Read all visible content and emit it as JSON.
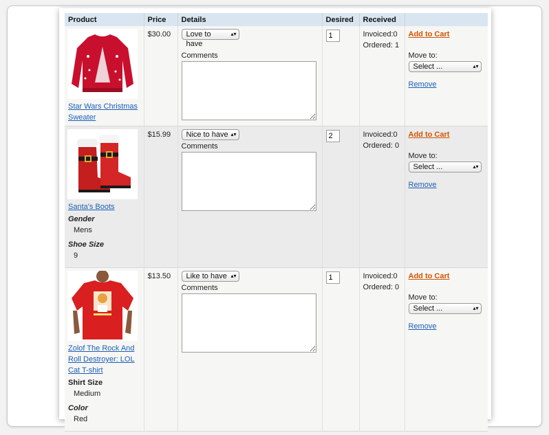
{
  "table": {
    "headers": {
      "product": "Product",
      "price": "Price",
      "details": "Details",
      "desired": "Desired",
      "received": "Received",
      "actions": ""
    },
    "common": {
      "comments_label": "Comments",
      "add_to_cart": "Add to Cart",
      "move_to_label": "Move to:",
      "move_to_select": "Select ...",
      "remove": "Remove",
      "accent_color": "#d35400",
      "link_color": "#1a5fb4",
      "header_bg": "#d9e5f0"
    },
    "rows": [
      {
        "name": "Star Wars Christmas Sweater",
        "image_icon": "red-christmas-sweater-image",
        "price": "$30.00",
        "priority": "Love to have",
        "comments": "",
        "desired": "1",
        "invoiced": "Invoiced:0",
        "ordered": "Ordered: 1",
        "attributes": []
      },
      {
        "name": "Santa's Boots",
        "image_icon": "red-santa-boots-image",
        "price": "$15.99",
        "priority": "Nice to have",
        "comments": "",
        "desired": "2",
        "invoiced": "Invoiced:0",
        "ordered": "Ordered: 0",
        "attributes": [
          {
            "name": "Gender",
            "value": "Mens"
          },
          {
            "name": "Shoe Size",
            "value": "9"
          }
        ]
      },
      {
        "name": "Zolof The Rock And Roll Destroyer: LOL Cat T-shirt",
        "image_icon": "red-cat-tshirt-image",
        "price": "$13.50",
        "priority": "Like to have",
        "comments": "",
        "desired": "1",
        "invoiced": "Invoiced:0",
        "ordered": "Ordered: 0",
        "attributes": [
          {
            "name": "Shirt Size",
            "value": "Medium"
          },
          {
            "name": "Color",
            "value": "Red"
          }
        ]
      }
    ]
  }
}
